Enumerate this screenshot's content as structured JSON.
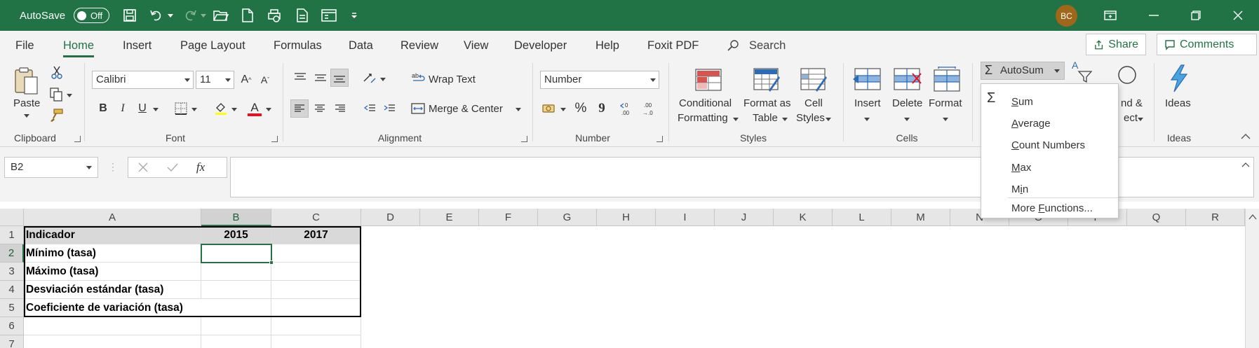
{
  "titlebar": {
    "autosave_label": "AutoSave",
    "autosave_state": "Off",
    "user_initials": "BC",
    "accent_color": "#217346",
    "avatar_color": "#a0671a"
  },
  "menu": {
    "tabs": [
      "File",
      "Home",
      "Insert",
      "Page Layout",
      "Formulas",
      "Data",
      "Review",
      "View",
      "Developer",
      "Help",
      "Foxit PDF"
    ],
    "active_tab": "Home",
    "search_label": "Search",
    "share_label": "Share",
    "comments_label": "Comments"
  },
  "ribbon": {
    "clipboard": {
      "paste_label": "Paste",
      "group_label": "Clipboard"
    },
    "font": {
      "font_name": "Calibri",
      "font_size": "11",
      "bold": "B",
      "italic": "I",
      "underline": "U",
      "group_label": "Font",
      "font_color": "#e81123"
    },
    "alignment": {
      "wrap_text": "Wrap Text",
      "merge_center": "Merge & Center",
      "group_label": "Alignment"
    },
    "number": {
      "format": "Number",
      "percent": "%",
      "comma": "9",
      "group_label": "Number"
    },
    "styles": {
      "conditional": "Conditional",
      "formatting": "Formatting",
      "format_as": "Format as",
      "table": "Table",
      "cell": "Cell",
      "styles": "Styles",
      "group_label": "Styles"
    },
    "cells": {
      "insert": "Insert",
      "delete": "Delete",
      "format": "Format",
      "group_label": "Cells"
    },
    "editing": {
      "autosum": "AutoSum",
      "partial_find_label": "nd &",
      "partial_select_label": "ect"
    },
    "ideas": {
      "label": "Ideas",
      "group_label": "Ideas"
    }
  },
  "autosum_menu": {
    "items": [
      {
        "label": "Sum",
        "ul": "S",
        "rest": "um"
      },
      {
        "label": "Average",
        "ul": "A",
        "rest": "verage"
      },
      {
        "label": "Count Numbers",
        "ul": "C",
        "rest": "ount Numbers"
      },
      {
        "label": "Max",
        "ul": "M",
        "rest": "ax"
      },
      {
        "label": "Min",
        "pre": "M",
        "ul": "i",
        "rest": "n"
      }
    ],
    "more": {
      "pre": "More ",
      "ul": "F",
      "rest": "unctions..."
    }
  },
  "formula_bar": {
    "name_box": "B2",
    "fx": "fx",
    "formula": ""
  },
  "sheet": {
    "columns": [
      "A",
      "B",
      "C",
      "D",
      "E",
      "F",
      "G",
      "H",
      "I",
      "J",
      "K",
      "L",
      "M",
      "N",
      "O",
      "P",
      "Q",
      "R"
    ],
    "rows": [
      "1",
      "2",
      "3",
      "4",
      "5",
      "6",
      "7"
    ],
    "selected_cell": "B2",
    "table": {
      "header": [
        "Indicador",
        "2015",
        "2017"
      ],
      "labels": [
        "Mínimo (tasa)",
        "Máximo (tasa)",
        "Desviación estándar (tasa)",
        "Coeficiente de variación  (tasa)"
      ]
    }
  }
}
